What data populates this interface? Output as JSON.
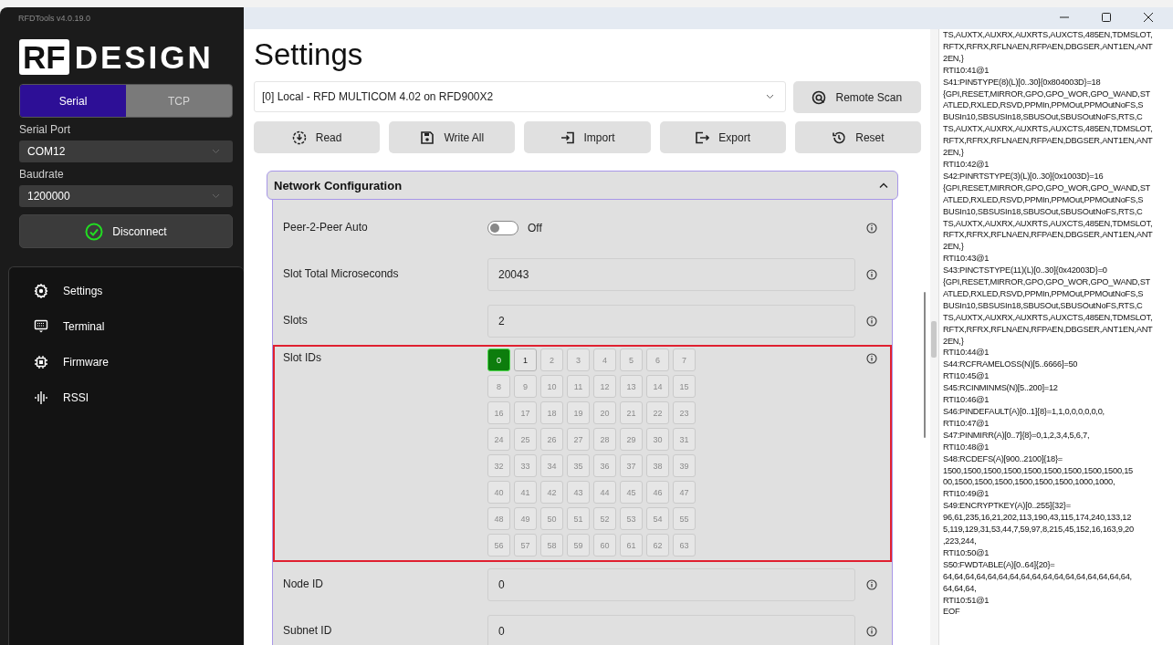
{
  "app": {
    "title": "RFDTools v4.0.19.0"
  },
  "sidebar": {
    "logo": {
      "boxed": "RF",
      "rest": "DESIGN"
    },
    "connection_tabs": [
      {
        "label": "Serial",
        "selected": true
      },
      {
        "label": "TCP",
        "selected": false
      }
    ],
    "serial_port": {
      "label": "Serial Port",
      "value": "COM12"
    },
    "baudrate": {
      "label": "Baudrate",
      "value": "1200000"
    },
    "connect_button": {
      "label": "Disconnect",
      "connected": true
    },
    "nav": [
      {
        "label": "Settings"
      },
      {
        "label": "Terminal"
      },
      {
        "label": "Firmware"
      },
      {
        "label": "RSSI"
      }
    ]
  },
  "page": {
    "title": "Settings",
    "device_select": "[0] Local  - RFD MULTICOM 4.02 on RFD900X2",
    "remote_scan": "Remote Scan",
    "actions": [
      {
        "label": "Read"
      },
      {
        "label": "Write All"
      },
      {
        "label": "Import"
      },
      {
        "label": "Export"
      },
      {
        "label": "Reset"
      }
    ],
    "section": {
      "title": "Network Configuration",
      "expanded": true,
      "fields": [
        {
          "kind": "toggle",
          "label": "Peer-2-Peer Auto",
          "on": false,
          "state_text": "Off"
        },
        {
          "kind": "input",
          "label": "Slot Total Microseconds",
          "value": "20043"
        },
        {
          "kind": "input",
          "label": "Slots",
          "value": "2"
        },
        {
          "kind": "slots",
          "label": "Slot IDs",
          "highlighted": true,
          "slots": [
            {
              "label": "0",
              "selected": true,
              "disabled": false
            },
            {
              "label": "1",
              "selected": false,
              "disabled": false
            },
            {
              "label": "2",
              "selected": false,
              "disabled": true
            },
            {
              "label": "3",
              "selected": false,
              "disabled": true
            },
            {
              "label": "4",
              "selected": false,
              "disabled": true
            },
            {
              "label": "5",
              "selected": false,
              "disabled": true
            },
            {
              "label": "6",
              "selected": false,
              "disabled": true
            },
            {
              "label": "7",
              "selected": false,
              "disabled": true
            },
            {
              "label": "8",
              "selected": false,
              "disabled": true
            },
            {
              "label": "9",
              "selected": false,
              "disabled": true
            },
            {
              "label": "10",
              "selected": false,
              "disabled": true
            },
            {
              "label": "11",
              "selected": false,
              "disabled": true
            },
            {
              "label": "12",
              "selected": false,
              "disabled": true
            },
            {
              "label": "13",
              "selected": false,
              "disabled": true
            },
            {
              "label": "14",
              "selected": false,
              "disabled": true
            },
            {
              "label": "15",
              "selected": false,
              "disabled": true
            },
            {
              "label": "16",
              "selected": false,
              "disabled": true
            },
            {
              "label": "17",
              "selected": false,
              "disabled": true
            },
            {
              "label": "18",
              "selected": false,
              "disabled": true
            },
            {
              "label": "19",
              "selected": false,
              "disabled": true
            },
            {
              "label": "20",
              "selected": false,
              "disabled": true
            },
            {
              "label": "21",
              "selected": false,
              "disabled": true
            },
            {
              "label": "22",
              "selected": false,
              "disabled": true
            },
            {
              "label": "23",
              "selected": false,
              "disabled": true
            },
            {
              "label": "24",
              "selected": false,
              "disabled": true
            },
            {
              "label": "25",
              "selected": false,
              "disabled": true
            },
            {
              "label": "26",
              "selected": false,
              "disabled": true
            },
            {
              "label": "27",
              "selected": false,
              "disabled": true
            },
            {
              "label": "28",
              "selected": false,
              "disabled": true
            },
            {
              "label": "29",
              "selected": false,
              "disabled": true
            },
            {
              "label": "30",
              "selected": false,
              "disabled": true
            },
            {
              "label": "31",
              "selected": false,
              "disabled": true
            },
            {
              "label": "32",
              "selected": false,
              "disabled": true
            },
            {
              "label": "33",
              "selected": false,
              "disabled": true
            },
            {
              "label": "34",
              "selected": false,
              "disabled": true
            },
            {
              "label": "35",
              "selected": false,
              "disabled": true
            },
            {
              "label": "36",
              "selected": false,
              "disabled": true
            },
            {
              "label": "37",
              "selected": false,
              "disabled": true
            },
            {
              "label": "38",
              "selected": false,
              "disabled": true
            },
            {
              "label": "39",
              "selected": false,
              "disabled": true
            },
            {
              "label": "40",
              "selected": false,
              "disabled": true
            },
            {
              "label": "41",
              "selected": false,
              "disabled": true
            },
            {
              "label": "42",
              "selected": false,
              "disabled": true
            },
            {
              "label": "43",
              "selected": false,
              "disabled": true
            },
            {
              "label": "44",
              "selected": false,
              "disabled": true
            },
            {
              "label": "45",
              "selected": false,
              "disabled": true
            },
            {
              "label": "46",
              "selected": false,
              "disabled": true
            },
            {
              "label": "47",
              "selected": false,
              "disabled": true
            },
            {
              "label": "48",
              "selected": false,
              "disabled": true
            },
            {
              "label": "49",
              "selected": false,
              "disabled": true
            },
            {
              "label": "50",
              "selected": false,
              "disabled": true
            },
            {
              "label": "51",
              "selected": false,
              "disabled": true
            },
            {
              "label": "52",
              "selected": false,
              "disabled": true
            },
            {
              "label": "53",
              "selected": false,
              "disabled": true
            },
            {
              "label": "54",
              "selected": false,
              "disabled": true
            },
            {
              "label": "55",
              "selected": false,
              "disabled": true
            },
            {
              "label": "56",
              "selected": false,
              "disabled": true
            },
            {
              "label": "57",
              "selected": false,
              "disabled": true
            },
            {
              "label": "58",
              "selected": false,
              "disabled": true
            },
            {
              "label": "59",
              "selected": false,
              "disabled": true
            },
            {
              "label": "60",
              "selected": false,
              "disabled": true
            },
            {
              "label": "61",
              "selected": false,
              "disabled": true
            },
            {
              "label": "62",
              "selected": false,
              "disabled": true
            },
            {
              "label": "63",
              "selected": false,
              "disabled": true
            }
          ]
        },
        {
          "kind": "input",
          "label": "Node ID",
          "value": "0"
        },
        {
          "kind": "input",
          "label": "Subnet ID",
          "value": "0"
        }
      ]
    }
  },
  "log": {
    "lines": [
      "TS,AUXTX,AUXRX,AUXRTS,AUXCTS,485EN,TDMSLOT,",
      "RFTX,RFRX,RFLNAEN,RFPAEN,DBGSER,ANT1EN,ANT",
      "2EN,}",
      "RTI10:41@1",
      "S41:PIN5TYPE(8)(L)[0..30]{0x804003D}=18",
      "{GPI,RESET,MIRROR,GPO,GPO_WOR,GPO_WAND,ST",
      "ATLED,RXLED,RSVD,PPMIn,PPMOut,PPMOutNoFS,S",
      "BUSIn10,SBSUSIn18,SBUSOut,SBUSOutNoFS,RTS,C",
      "TS,AUXTX,AUXRX,AUXRTS,AUXCTS,485EN,TDMSLOT,",
      "RFTX,RFRX,RFLNAEN,RFPAEN,DBGSER,ANT1EN,ANT",
      "2EN,}",
      "RTI10:42@1",
      "S42:PINRTSTYPE(3)(L)[0..30]{0x1003D}=16",
      "{GPI,RESET,MIRROR,GPO,GPO_WOR,GPO_WAND,ST",
      "ATLED,RXLED,RSVD,PPMIn,PPMOut,PPMOutNoFS,S",
      "BUSIn10,SBSUSIn18,SBUSOut,SBUSOutNoFS,RTS,C",
      "TS,AUXTX,AUXRX,AUXRTS,AUXCTS,485EN,TDMSLOT,",
      "RFTX,RFRX,RFLNAEN,RFPAEN,DBGSER,ANT1EN,ANT",
      "2EN,}",
      "RTI10:43@1",
      "S43:PINCTSTYPE(11)(L)[0..30]{0x42003D}=0",
      "{GPI,RESET,MIRROR,GPO,GPO_WOR,GPO_WAND,ST",
      "ATLED,RXLED,RSVD,PPMIn,PPMOut,PPMOutNoFS,S",
      "BUSIn10,SBSUSIn18,SBUSOut,SBUSOutNoFS,RTS,C",
      "TS,AUXTX,AUXRX,AUXRTS,AUXCTS,485EN,TDMSLOT,",
      "RFTX,RFRX,RFLNAEN,RFPAEN,DBGSER,ANT1EN,ANT",
      "2EN,}",
      "RTI10:44@1",
      "S44:RCFRAMELOSS(N)[5..6666]=50",
      "RTI10:45@1",
      "S45:RCINMINMS(N)[5..200]=12",
      "RTI10:46@1",
      "S46:PINDEFAULT(A)[0..1]{8}=1,1,0,0,0,0,0,0,",
      "RTI10:47@1",
      "S47:PINMIRR(A)[0..7]{8}=0,1,2,3,4,5,6,7,",
      "RTI10:48@1",
      "S48:RCDEFS(A)[900..2100]{18}=",
      "1500,1500,1500,1500,1500,1500,1500,1500,1500,15",
      "00,1500,1500,1500,1500,1500,1500,1000,1000,",
      "RTI10:49@1",
      "S49:ENCRYPTKEY(A)[0..255]{32}=",
      "96,61,235,16,21,202,113,190,43,115,174,240,133,12",
      "5,119,129,31,53,44,7,59,97,8,215,45,152,16,163,9,20",
      ",223,244,",
      "RTI10:50@1",
      "S50:FWDTABLE(A)[0..64]{20}=",
      "64,64,64,64,64,64,64,64,64,64,64,64,64,64,64,64,64,",
      "64,64,64,",
      "RTI10:51@1",
      "EOF"
    ]
  }
}
